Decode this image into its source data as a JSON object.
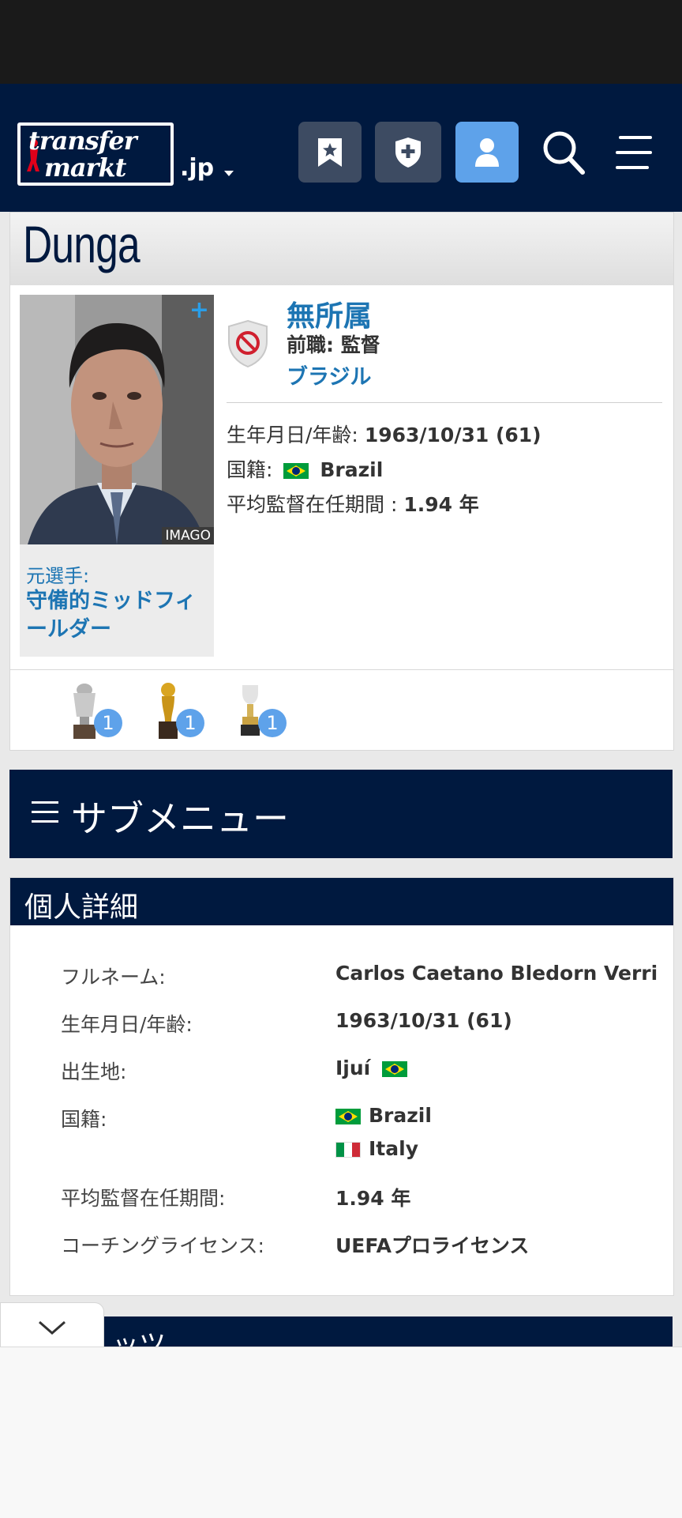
{
  "nav": {
    "logo_line1": "transfer",
    "logo_line2": "markt",
    "domain": ".jp"
  },
  "player": {
    "name": "Dunga",
    "photo_credit": "IMAGO",
    "former_label": "元選手:",
    "former_position": "守備的ミッドフィールダー",
    "club": "無所属",
    "prev_role": "前職: 監督",
    "club_country": "ブラジル",
    "birth_label": "生年月日/年齢:",
    "birth_value": "1963/10/31 (61)",
    "nationality_label": "国籍:",
    "nationality_value": "Brazil",
    "tenure_label": "平均監督在任期間 :",
    "tenure_value": "1.94 年"
  },
  "trophies": [
    {
      "icon": "copa-america-trophy-icon",
      "count": "1"
    },
    {
      "icon": "world-cup-trophy-icon",
      "count": "1"
    },
    {
      "icon": "confederations-cup-trophy-icon",
      "count": "1"
    }
  ],
  "submenu": {
    "label": "サブメニュー"
  },
  "details": {
    "title": "個人詳細",
    "rows": [
      {
        "label": "フルネーム:",
        "value": "Carlos Caetano Bledorn Verri"
      },
      {
        "label": "生年月日/年齢:",
        "value": "1963/10/31 (61)"
      },
      {
        "label": "出生地:",
        "value": "Ijuí"
      },
      {
        "label": "国籍:",
        "value": "Brazil",
        "value2": "Italy"
      },
      {
        "label": "平均監督在任期間:",
        "value": "1.94 年"
      },
      {
        "label": "コーチングライセンス:",
        "value": "UEFAプロライセンス"
      }
    ]
  },
  "next_section": {
    "title_partial": "ッツ"
  },
  "colors": {
    "navy": "#00193f",
    "accent_blue": "#5ea2ea",
    "link_blue": "#1d75b3"
  }
}
